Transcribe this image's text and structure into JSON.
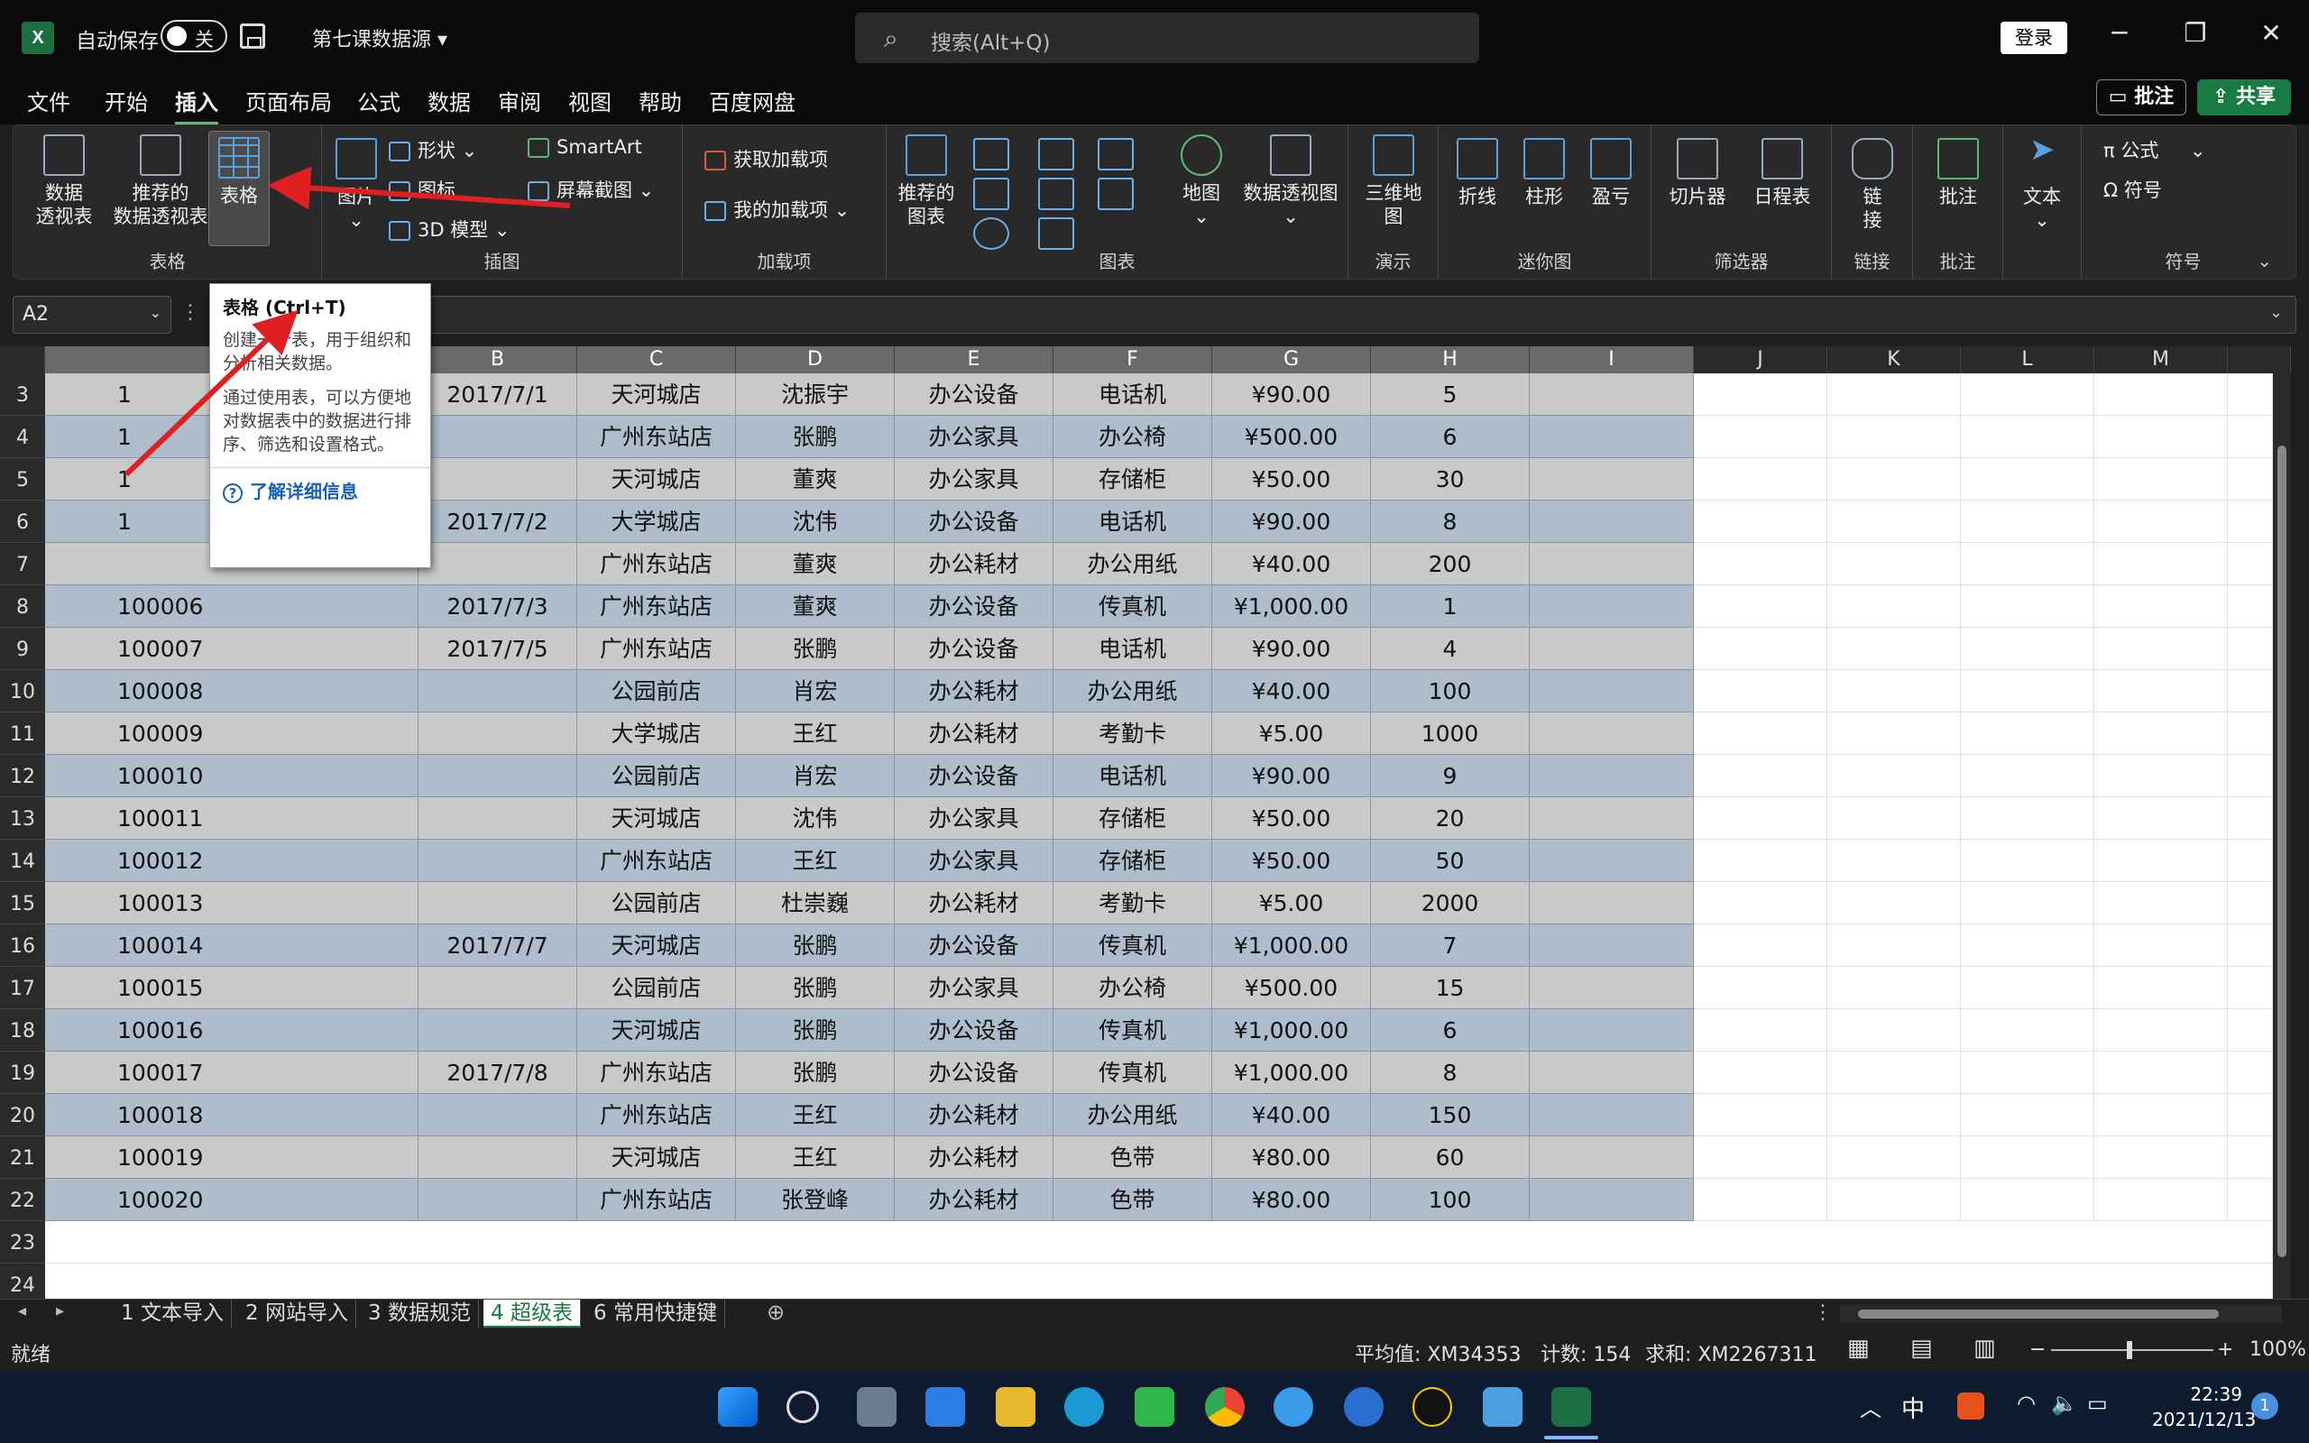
{
  "titlebar": {
    "autosave_label": "自动保存",
    "autosave_state": "关",
    "file_name": "第七课数据源",
    "search_placeholder": "搜索(Alt+Q)",
    "login_label": "登录"
  },
  "menu": [
    "文件",
    "开始",
    "插入",
    "页面布局",
    "公式",
    "数据",
    "审阅",
    "视图",
    "帮助",
    "百度网盘"
  ],
  "menu_active": "插入",
  "actions": {
    "comment": "批注",
    "share": "共享"
  },
  "ribbon": {
    "groups": {
      "table": "表格",
      "illustrations": "插图",
      "addins": "加载项",
      "charts": "图表",
      "tours": "演示",
      "sparklines": "迷你图",
      "filters": "筛选器",
      "links": "链接",
      "comments": "批注",
      "symbols": "符号"
    },
    "buttons": {
      "pivot": "数据\n透视表",
      "rec_pivot": "推荐的\n数据透视表",
      "table": "表格",
      "pictures": "图片",
      "shapes": "形状",
      "icons": "图标",
      "model3d": "3D 模型",
      "smartart": "SmartArt",
      "screenshot": "屏幕截图",
      "get_addins": "获取加载项",
      "my_addins": "我的加载项",
      "rec_charts": "推荐的\n图表",
      "maps": "地图",
      "pivot_chart": "数据透视图",
      "map3d": "三维地\n图",
      "spark_line": "折线",
      "spark_col": "柱形",
      "spark_wl": "盈亏",
      "slicer": "切片器",
      "timeline": "日程表",
      "link": "链\n接",
      "comment": "批注",
      "text": "文本",
      "equation": "公式",
      "symbol": "符号"
    }
  },
  "formula_bar": {
    "name_box": "A2"
  },
  "tooltip": {
    "title": "表格 (Ctrl+T)",
    "p1": "创建一个表，用于组织和分析相关数据。",
    "p2": "通过使用表，可以方便地对数据表中的数据进行排序、筛选和设置格式。",
    "link": "了解详细信息"
  },
  "columns": [
    "B",
    "C",
    "D",
    "E",
    "F",
    "G",
    "H",
    "I",
    "J",
    "K",
    "L",
    "M"
  ],
  "rows": [
    {
      "n": "3",
      "a": "1",
      "b": "2017/7/1",
      "c": "天河城店",
      "d": "沈振宇",
      "e": "办公设备",
      "f": "电话机",
      "g": "¥90.00",
      "h": "5"
    },
    {
      "n": "4",
      "a": "1",
      "b": "",
      "c": "广州东站店",
      "d": "张鹏",
      "e": "办公家具",
      "f": "办公椅",
      "g": "¥500.00",
      "h": "6"
    },
    {
      "n": "5",
      "a": "1",
      "b": "",
      "c": "天河城店",
      "d": "董爽",
      "e": "办公家具",
      "f": "存储柜",
      "g": "¥50.00",
      "h": "30"
    },
    {
      "n": "6",
      "a": "1",
      "b": "2017/7/2",
      "c": "大学城店",
      "d": "沈伟",
      "e": "办公设备",
      "f": "电话机",
      "g": "¥90.00",
      "h": "8"
    },
    {
      "n": "7",
      "a": "",
      "b": "",
      "c": "广州东站店",
      "d": "董爽",
      "e": "办公耗材",
      "f": "办公用纸",
      "g": "¥40.00",
      "h": "200"
    },
    {
      "n": "8",
      "a": "100006",
      "b": "2017/7/3",
      "c": "广州东站店",
      "d": "董爽",
      "e": "办公设备",
      "f": "传真机",
      "g": "¥1,000.00",
      "h": "1"
    },
    {
      "n": "9",
      "a": "100007",
      "b": "2017/7/5",
      "c": "广州东站店",
      "d": "张鹏",
      "e": "办公设备",
      "f": "电话机",
      "g": "¥90.00",
      "h": "4"
    },
    {
      "n": "10",
      "a": "100008",
      "b": "",
      "c": "公园前店",
      "d": "肖宏",
      "e": "办公耗材",
      "f": "办公用纸",
      "g": "¥40.00",
      "h": "100"
    },
    {
      "n": "11",
      "a": "100009",
      "b": "",
      "c": "大学城店",
      "d": "王红",
      "e": "办公耗材",
      "f": "考勤卡",
      "g": "¥5.00",
      "h": "1000"
    },
    {
      "n": "12",
      "a": "100010",
      "b": "",
      "c": "公园前店",
      "d": "肖宏",
      "e": "办公设备",
      "f": "电话机",
      "g": "¥90.00",
      "h": "9"
    },
    {
      "n": "13",
      "a": "100011",
      "b": "",
      "c": "天河城店",
      "d": "沈伟",
      "e": "办公家具",
      "f": "存储柜",
      "g": "¥50.00",
      "h": "20"
    },
    {
      "n": "14",
      "a": "100012",
      "b": "",
      "c": "广州东站店",
      "d": "王红",
      "e": "办公家具",
      "f": "存储柜",
      "g": "¥50.00",
      "h": "50"
    },
    {
      "n": "15",
      "a": "100013",
      "b": "",
      "c": "公园前店",
      "d": "杜崇巍",
      "e": "办公耗材",
      "f": "考勤卡",
      "g": "¥5.00",
      "h": "2000"
    },
    {
      "n": "16",
      "a": "100014",
      "b": "2017/7/7",
      "c": "天河城店",
      "d": "张鹏",
      "e": "办公设备",
      "f": "传真机",
      "g": "¥1,000.00",
      "h": "7"
    },
    {
      "n": "17",
      "a": "100015",
      "b": "",
      "c": "公园前店",
      "d": "张鹏",
      "e": "办公家具",
      "f": "办公椅",
      "g": "¥500.00",
      "h": "15"
    },
    {
      "n": "18",
      "a": "100016",
      "b": "",
      "c": "天河城店",
      "d": "张鹏",
      "e": "办公设备",
      "f": "传真机",
      "g": "¥1,000.00",
      "h": "6"
    },
    {
      "n": "19",
      "a": "100017",
      "b": "2017/7/8",
      "c": "广州东站店",
      "d": "张鹏",
      "e": "办公设备",
      "f": "传真机",
      "g": "¥1,000.00",
      "h": "8"
    },
    {
      "n": "20",
      "a": "100018",
      "b": "",
      "c": "广州东站店",
      "d": "王红",
      "e": "办公耗材",
      "f": "办公用纸",
      "g": "¥40.00",
      "h": "150"
    },
    {
      "n": "21",
      "a": "100019",
      "b": "",
      "c": "天河城店",
      "d": "王红",
      "e": "办公耗材",
      "f": "色带",
      "g": "¥80.00",
      "h": "60"
    },
    {
      "n": "22",
      "a": "100020",
      "b": "",
      "c": "广州东站店",
      "d": "张登峰",
      "e": "办公耗材",
      "f": "色带",
      "g": "¥80.00",
      "h": "100"
    }
  ],
  "empty_rows": [
    "23",
    "24"
  ],
  "sheet_tabs": [
    "1 文本导入",
    "2 网站导入",
    "3 数据规范",
    "4 超级表",
    "6 常用快捷键"
  ],
  "active_tab": "4 超级表",
  "status": {
    "ready": "就绪",
    "average": "平均值: XM34353",
    "count": "计数: 154",
    "sum": "求和: XM2267311",
    "zoom": "100%"
  },
  "taskbar": {
    "ime": "中",
    "time": "22:39",
    "date": "2021/12/13",
    "notification_count": "1"
  },
  "colors": {
    "accent": "#1a7a43",
    "row_gray": "#c9c9c9",
    "row_blue": "#aebccb",
    "arrow": "#e02020"
  }
}
